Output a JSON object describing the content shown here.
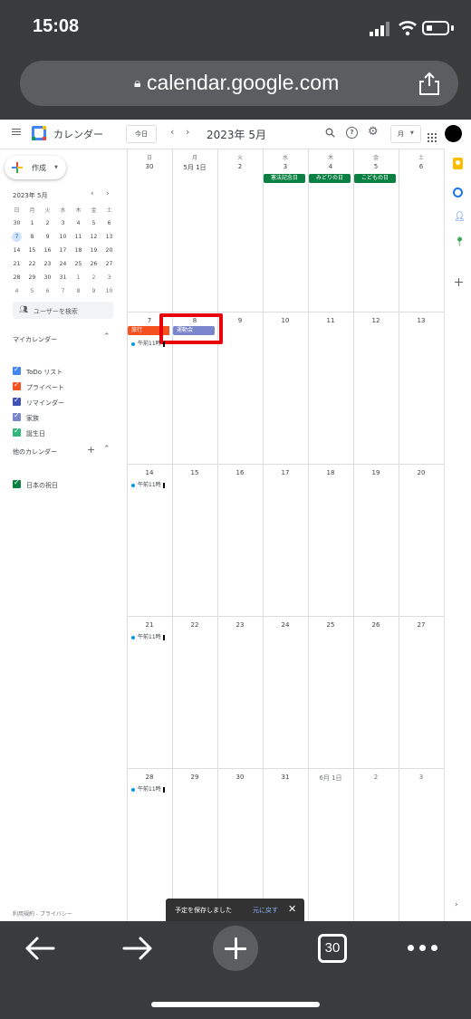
{
  "status": {
    "time": "15:08"
  },
  "browser": {
    "url": "calendar.google.com",
    "tab_count": "30"
  },
  "header": {
    "app_title": "カレンダー",
    "today_button": "今日",
    "period": "2023年 5月",
    "view_select": "月"
  },
  "sidebar": {
    "create_label": "作成",
    "mini_month": "2023年 5月",
    "mini_dow": [
      "日",
      "月",
      "火",
      "水",
      "木",
      "金",
      "土"
    ],
    "mini_weeks": [
      [
        "30",
        "1",
        "2",
        "3",
        "4",
        "5",
        "6"
      ],
      [
        "7",
        "8",
        "9",
        "10",
        "11",
        "12",
        "13"
      ],
      [
        "14",
        "15",
        "16",
        "17",
        "18",
        "19",
        "20"
      ],
      [
        "21",
        "22",
        "23",
        "24",
        "25",
        "26",
        "27"
      ],
      [
        "28",
        "29",
        "30",
        "31",
        "1",
        "2",
        "3"
      ],
      [
        "4",
        "5",
        "6",
        "7",
        "8",
        "9",
        "10"
      ]
    ],
    "search_users_placeholder": "ユーザーを検索",
    "my_calendars_title": "マイカレンダー",
    "my_calendars": [
      {
        "label": "ToDo リスト",
        "color": "#4285f4"
      },
      {
        "label": "プライベート",
        "color": "#f4511e"
      },
      {
        "label": "リマインダー",
        "color": "#3f51b5"
      },
      {
        "label": "家族",
        "color": "#7986cb"
      },
      {
        "label": "誕生日",
        "color": "#33b679"
      }
    ],
    "other_calendars_title": "他のカレンダー",
    "other_calendars": [
      {
        "label": "日本の祝日",
        "color": "#0b8043"
      }
    ],
    "footer": "利用規約 - プライバシー"
  },
  "calendar": {
    "dow": [
      "日",
      "月",
      "火",
      "水",
      "木",
      "金",
      "土"
    ],
    "weeks": [
      [
        "30",
        "5月 1日",
        "2",
        "3",
        "4",
        "5",
        "6"
      ],
      [
        "7",
        "8",
        "9",
        "10",
        "11",
        "12",
        "13"
      ],
      [
        "14",
        "15",
        "16",
        "17",
        "18",
        "19",
        "20"
      ],
      [
        "21",
        "22",
        "23",
        "24",
        "25",
        "26",
        "27"
      ],
      [
        "28",
        "29",
        "30",
        "31",
        "6月 1日",
        "2",
        "3"
      ]
    ],
    "holidays": [
      "憲法記念日",
      "みどりの日",
      "こどもの日"
    ],
    "event_travel": "旅行",
    "event_sports": "運動会",
    "recurring_event": "午前11時"
  },
  "snackbar": {
    "message": "予定を保存しました",
    "undo": "元に戻す"
  },
  "colors": {
    "highlight": "#e8000b",
    "holiday": "#0b8043",
    "travel": "#f4511e",
    "sports": "#7986cb"
  }
}
